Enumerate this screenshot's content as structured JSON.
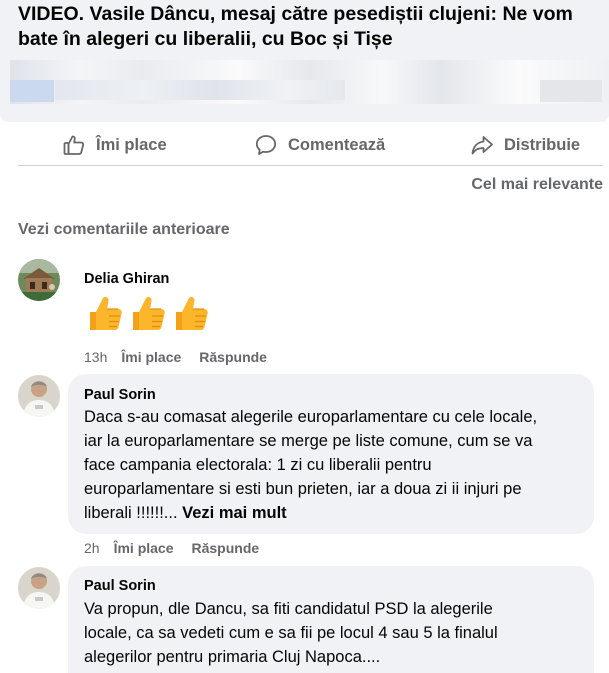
{
  "post": {
    "title": "VIDEO. Vasile Dâncu, mesaj către pesediștii clujeni: Ne vom bate în alegeri cu liberalii, cu Boc și Tișe"
  },
  "actions": {
    "like_label": "Îmi place",
    "comment_label": "Comentează",
    "share_label": "Distribuie"
  },
  "sort_label": "Cel mai relevante",
  "previous_comments_label": "Vezi comentariile anterioare",
  "comments": [
    {
      "author": "Delia Ghiran",
      "text": "",
      "emoji": [
        "thumbs-up",
        "thumbs-up",
        "thumbs-up"
      ],
      "time": "13h",
      "like_label": "Îmi place",
      "reply_label": "Răspunde"
    },
    {
      "author": "Paul Sorin",
      "lines": [
        "Daca s-au comasat alegerile europarlamentare cu cele locale,",
        "iar la europarlamentare se merge pe liste comune, cum se va",
        "face campania electorala: 1 zi cu liberalii pentru",
        "europarlamentare si esti bun prieten, iar a doua zi ii injuri pe",
        "liberali !!!!!!..."
      ],
      "see_more": "Vezi mai mult",
      "time": "2h",
      "like_label": "Îmi place",
      "reply_label": "Răspunde"
    },
    {
      "author": "Paul Sorin",
      "lines": [
        "Va propun, dle Dancu, sa fiti candidatul PSD la alegerile",
        "locale, ca sa vedeti cum e sa fii pe locul 4 sau 5 la finalul",
        "alegerilor pentru primaria Cluj Napoca...."
      ]
    }
  ],
  "colors": {
    "background": "#ffffff",
    "bubble": "#f0f2f5",
    "secondary_text": "#65676b",
    "primary_text": "#050505",
    "thumb_yellow": "#fbb62c"
  }
}
